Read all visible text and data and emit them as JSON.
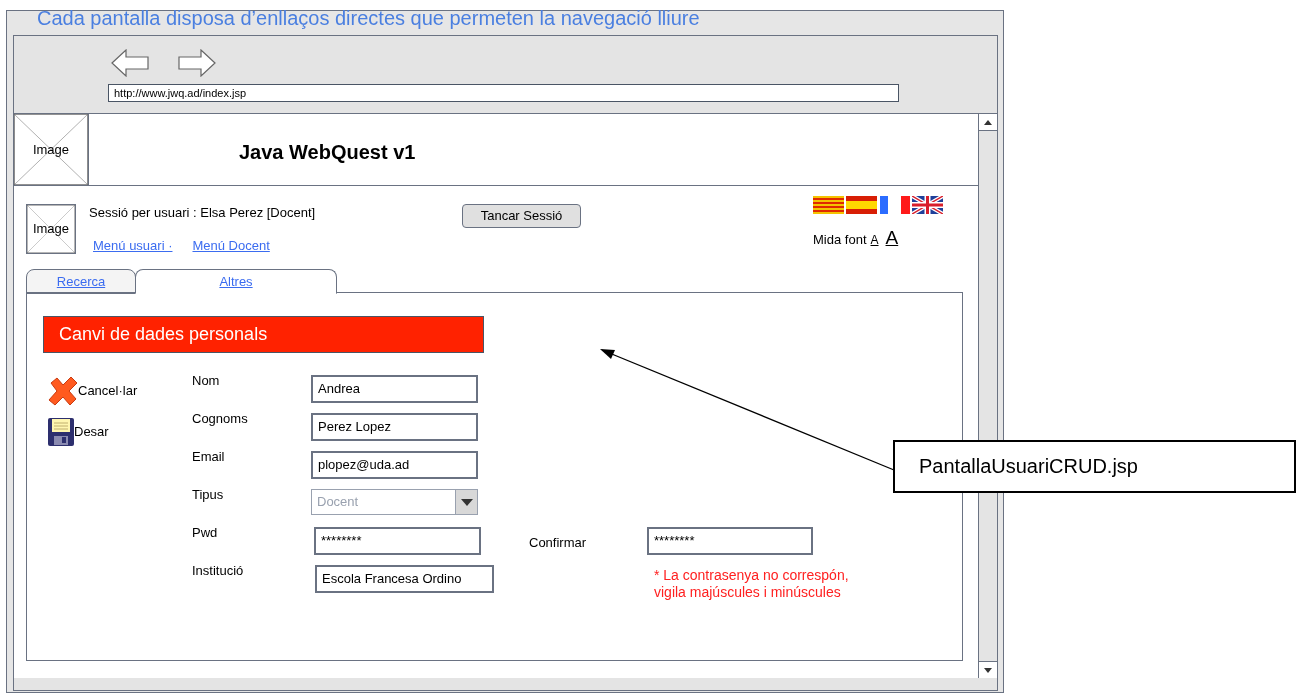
{
  "caption": "Cada pantalla disposa d’enllaços directes que permeten la navegació lliure",
  "browser": {
    "url": "http://www.jwq.ad/index.jsp"
  },
  "header": {
    "image_label": "Image",
    "title": "Java WebQuest v1"
  },
  "session": {
    "image_label": "Image",
    "text": "Sessió per usuari : Elsa Perez [Docent]",
    "links": [
      "Menú usuari ·",
      "Menú Docent"
    ],
    "logout_button": "Tancar Sessió"
  },
  "font_size": {
    "label": "Mida font",
    "small": "A",
    "large": "A"
  },
  "tabs": [
    {
      "label": "Recerca",
      "selected": false
    },
    {
      "label": "Altres",
      "selected": true
    }
  ],
  "panel": {
    "title": "Canvi de dades personals",
    "actions": [
      {
        "kind": "cancel",
        "label": "Cancel·lar"
      },
      {
        "kind": "save",
        "label": "Desar"
      }
    ],
    "fields": [
      {
        "kind": "text",
        "label": "Nom",
        "value": "Andrea"
      },
      {
        "kind": "text",
        "label": "Cognoms",
        "value": "Perez Lopez"
      },
      {
        "kind": "text",
        "label": "Email",
        "value": "plopez@uda.ad"
      },
      {
        "kind": "select",
        "label": "Tipus",
        "value": "Docent",
        "disabled": true
      },
      {
        "kind": "password",
        "label": "Pwd",
        "value": "********"
      },
      {
        "kind": "text",
        "label": "Institució",
        "value": "Escola Francesa Ordino"
      }
    ],
    "confirm": {
      "label": "Confirmar",
      "value": "********"
    },
    "error": "* La contrasenya no correspón, vigila majúscules i minúscules"
  },
  "annotation": "PantallaUsuariCRUD.jsp"
}
